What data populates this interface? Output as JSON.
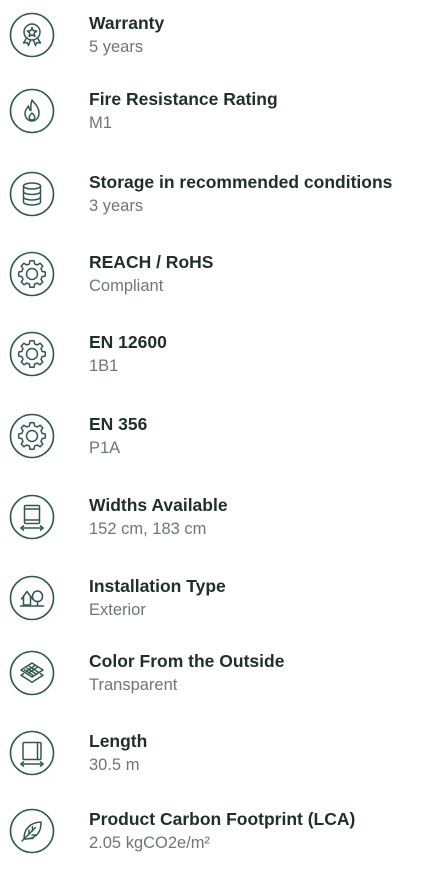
{
  "specs": [
    {
      "title": "Warranty",
      "value": "5 years",
      "icon": "award-badge-icon"
    },
    {
      "title": "Fire Resistance Rating",
      "value": "M1",
      "icon": "flame-icon"
    },
    {
      "title": "Storage in recommended conditions",
      "value": "3 years",
      "icon": "database-icon"
    },
    {
      "title": "REACH / RoHS",
      "value": "Compliant",
      "icon": "gear-icon"
    },
    {
      "title": "EN 12600",
      "value": "1B1",
      "icon": "gear-icon"
    },
    {
      "title": "EN 356",
      "value": "P1A",
      "icon": "gear-icon"
    },
    {
      "title": "Widths Available",
      "value": "152 cm, 183 cm",
      "icon": "roll-width-icon"
    },
    {
      "title": "Installation Type",
      "value": "Exterior",
      "icon": "tree-house-icon"
    },
    {
      "title": "Color From the Outside",
      "value": "Transparent",
      "icon": "layers-icon"
    },
    {
      "title": "Length",
      "value": "30.5 m",
      "icon": "roll-length-icon"
    },
    {
      "title": "Product Carbon Footprint (LCA)",
      "value": "2.05 kgCO2e/m²",
      "icon": "leaf-icon"
    }
  ],
  "colors": {
    "icon": "#2f5a4d",
    "title": "#1f2f2a",
    "value": "#6f7773"
  }
}
